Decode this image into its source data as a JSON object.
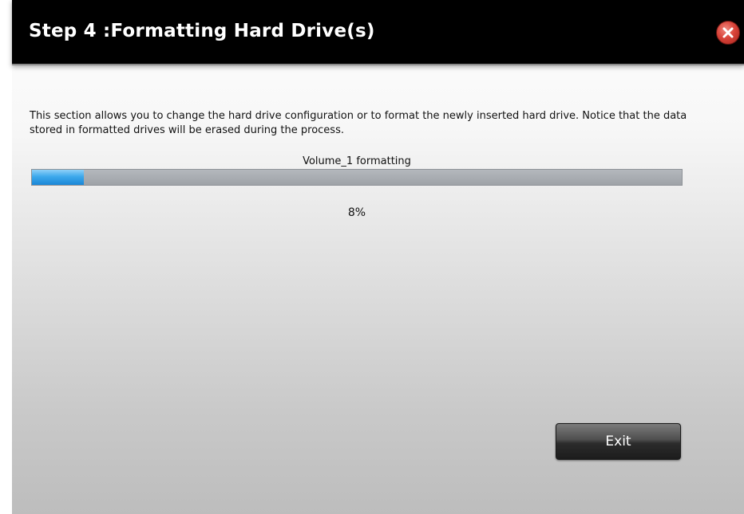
{
  "dialog": {
    "title": "Step 4 :Formatting Hard Drive(s)",
    "description": "This section allows you to change the hard drive configuration or to format the newly inserted hard drive. Notice that the data stored in formatted drives will be erased during the process.",
    "progress": {
      "label": "Volume_1 formatting",
      "percent_text": "8%",
      "value": 0.08
    },
    "exit_label": "Exit",
    "close_icon": "close-icon"
  },
  "colors": {
    "titlebar_bg": "#000000",
    "close_red": "#d9443a",
    "progress_fill": "#3da9ec",
    "progress_track": "#a8acb1"
  }
}
